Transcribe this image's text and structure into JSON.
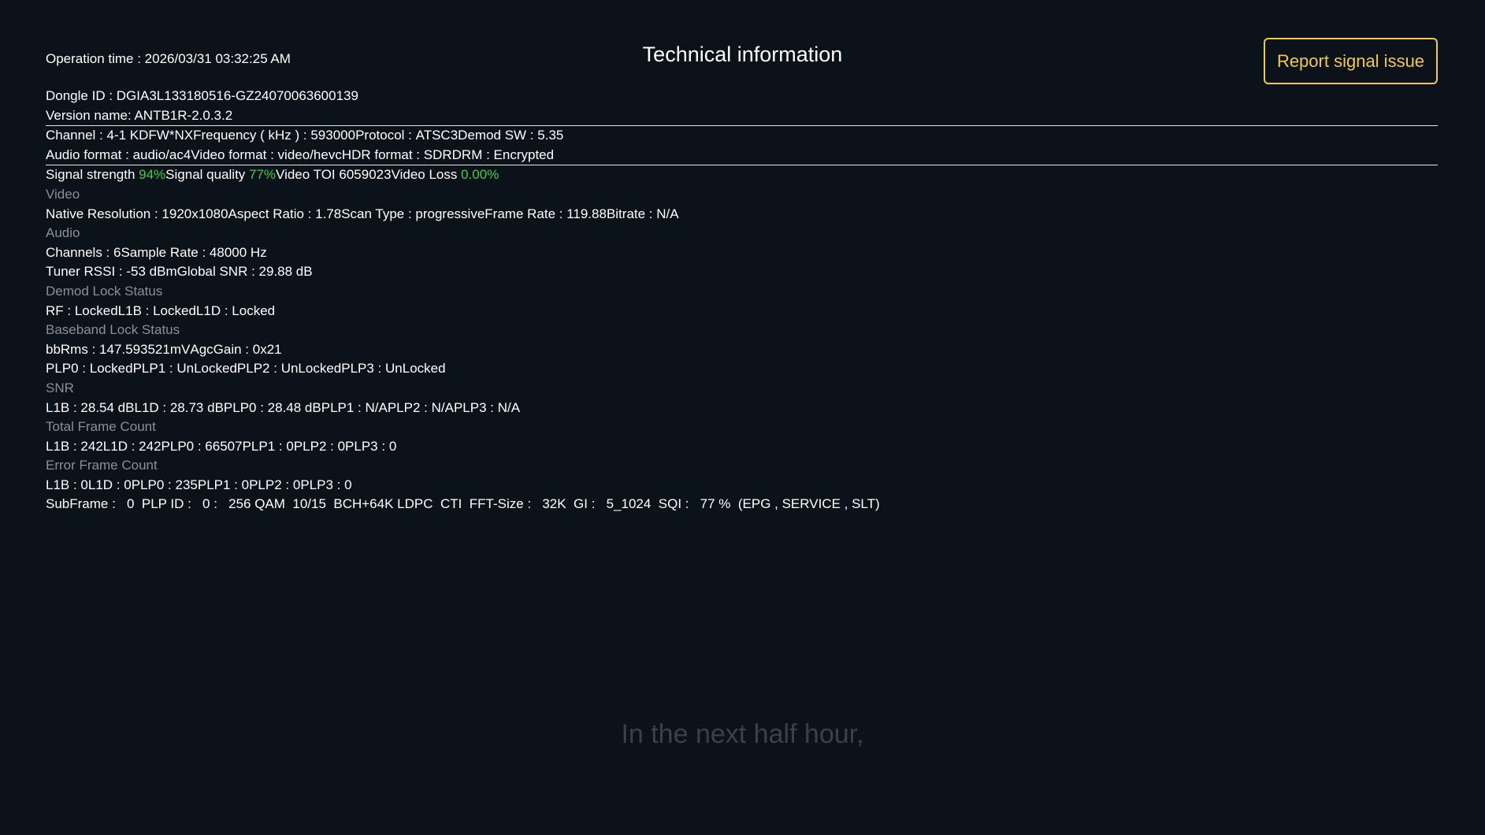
{
  "header": {
    "operation_time": "Operation time : 2026/03/31 03:32:25 AM",
    "title": "Technical information",
    "report_button": "Report signal issue"
  },
  "info": {
    "dongle_id": "Dongle ID : DGIA3L133180516-GZ24070063600139",
    "version_name": "Version name: ANTB1R-2.0.3.2",
    "channel_row": [
      {
        "label": "Channel : ",
        "value": "4-1 KDFW*NX"
      },
      {
        "label": "Frequency ( kHz ) : ",
        "value": "593000"
      },
      {
        "label": "Protocol : ",
        "value": "ATSC3"
      },
      {
        "label": "Demod SW : ",
        "value": "5.35"
      }
    ],
    "format_row": [
      {
        "label": "Audio format : ",
        "value": "audio/ac4"
      },
      {
        "label": "Video format : ",
        "value": "video/hevc"
      },
      {
        "label": "HDR format : ",
        "value": "SDR"
      },
      {
        "label": "DRM : ",
        "value": "Encrypted"
      }
    ],
    "signal_row": [
      {
        "label": "Signal strength ",
        "value": "94%",
        "color": "#3ecf4a"
      },
      {
        "label": "Signal quality ",
        "value": "77%",
        "color": "#3ecf4a"
      },
      {
        "label": "Video TOI ",
        "value": "6059023",
        "color": "#ffffff"
      },
      {
        "label": "Video Loss ",
        "value": "0.00%",
        "color": "#3ecf4a"
      }
    ],
    "video_section": "Video",
    "video_row": [
      {
        "label": "Native Resolution : ",
        "value": "1920x1080"
      },
      {
        "label": "Aspect Ratio : ",
        "value": "1.78"
      },
      {
        "label": "Scan Type : ",
        "value": "progressive"
      },
      {
        "label": "Frame Rate : ",
        "value": "119.88"
      },
      {
        "label": "Bitrate : ",
        "value": "N/A"
      }
    ],
    "audio_section": "Audio",
    "audio_row": [
      {
        "label": "Channels : ",
        "value": "6"
      },
      {
        "label": "Sample Rate : ",
        "value": "48000 Hz"
      }
    ],
    "tuner_row": [
      {
        "label": "Tuner RSSI : ",
        "value": "-53 dBm"
      },
      {
        "label": "Global SNR : ",
        "value": "29.88 dB"
      }
    ],
    "demod_section": "Demod Lock Status",
    "demod_row": [
      {
        "label": "RF : ",
        "value": "Locked"
      },
      {
        "label": "L1B : ",
        "value": "Locked"
      },
      {
        "label": "L1D : ",
        "value": "Locked"
      }
    ],
    "baseband_section": "Baseband Lock Status",
    "bb_row": [
      {
        "label": "bbRms : ",
        "value": "147.593521mV"
      },
      {
        "label": "AgcGain : ",
        "value": "0x21"
      }
    ],
    "plp_lock_row": [
      {
        "label": "PLP0 : ",
        "value": "Locked"
      },
      {
        "label": "PLP1 : ",
        "value": "UnLocked"
      },
      {
        "label": "PLP2 : ",
        "value": "UnLocked"
      },
      {
        "label": "PLP3 : ",
        "value": "UnLocked"
      }
    ],
    "snr_section": "SNR",
    "snr_row": [
      {
        "label": "L1B : ",
        "value": "28.54 dB"
      },
      {
        "label": "L1D : ",
        "value": "28.73 dB"
      },
      {
        "label": "PLP0 : ",
        "value": "28.48 dB"
      },
      {
        "label": "PLP1 : ",
        "value": "N/A"
      },
      {
        "label": "PLP2 : ",
        "value": "N/A"
      },
      {
        "label": "PLP3 : ",
        "value": "N/A"
      }
    ],
    "total_frame_section": "Total Frame Count",
    "total_frame_row": [
      {
        "label": "L1B : ",
        "value": "242"
      },
      {
        "label": "L1D : ",
        "value": "242"
      },
      {
        "label": "PLP0 : ",
        "value": "66507"
      },
      {
        "label": "PLP1 : ",
        "value": "0"
      },
      {
        "label": "PLP2 : ",
        "value": "0"
      },
      {
        "label": "PLP3 : ",
        "value": "0"
      }
    ],
    "error_frame_section": "Error Frame Count",
    "error_frame_row": [
      {
        "label": "L1B : ",
        "value": "0"
      },
      {
        "label": "L1D : ",
        "value": "0"
      },
      {
        "label": "PLP0 : ",
        "value": "235"
      },
      {
        "label": "PLP1 : ",
        "value": "0"
      },
      {
        "label": "PLP2 : ",
        "value": "0"
      },
      {
        "label": "PLP3 : ",
        "value": "0"
      }
    ],
    "subframe_line": "SubFrame :   0  PLP ID :   0 :   256 QAM  10/15  BCH+64K LDPC  CTI  FFT-Size :   32K  GI :   5_1024  SQI :   77 %  (EPG , SERVICE , SLT)"
  },
  "watermark": "In the next half hour,"
}
